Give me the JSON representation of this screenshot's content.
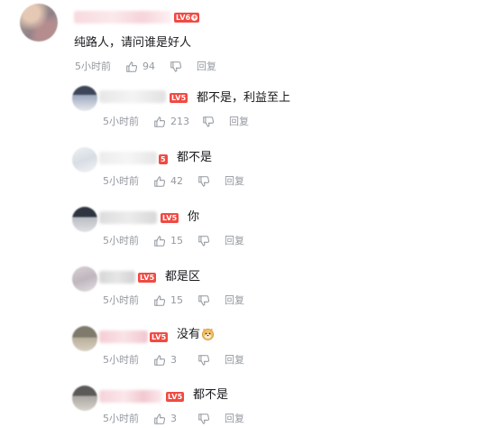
{
  "main_comment": {
    "level": "LV6",
    "text": "纯路人，请问谁是好人",
    "time": "5小时前",
    "likes": "94",
    "reply_label": "回复"
  },
  "replies": [
    {
      "level": "LV5",
      "text": "都不是，利益至上",
      "time": "5小时前",
      "likes": "213",
      "reply_label": "回复"
    },
    {
      "level": "5",
      "text": "都不是",
      "time": "5小时前",
      "likes": "42",
      "reply_label": "回复"
    },
    {
      "level": "LV5",
      "text": "你",
      "time": "5小时前",
      "likes": "15",
      "reply_label": "回复"
    },
    {
      "level": "LV5",
      "text": "都是区",
      "time": "5小时前",
      "likes": "15",
      "reply_label": "回复"
    },
    {
      "level": "LV5",
      "text": "没有",
      "time": "5小时前",
      "likes": "3",
      "reply_label": "回复"
    },
    {
      "level": "LV5",
      "text": "都不是",
      "time": "5小时前",
      "likes": "3",
      "reply_label": "回复"
    }
  ],
  "colors": {
    "level_badge": "#f04a43",
    "meta_text": "#9499a0",
    "body_text": "#18191c"
  },
  "icons": {
    "like": "thumbs-up-icon",
    "dislike": "thumbs-down-icon",
    "emoji": "doge-emoji-icon"
  }
}
